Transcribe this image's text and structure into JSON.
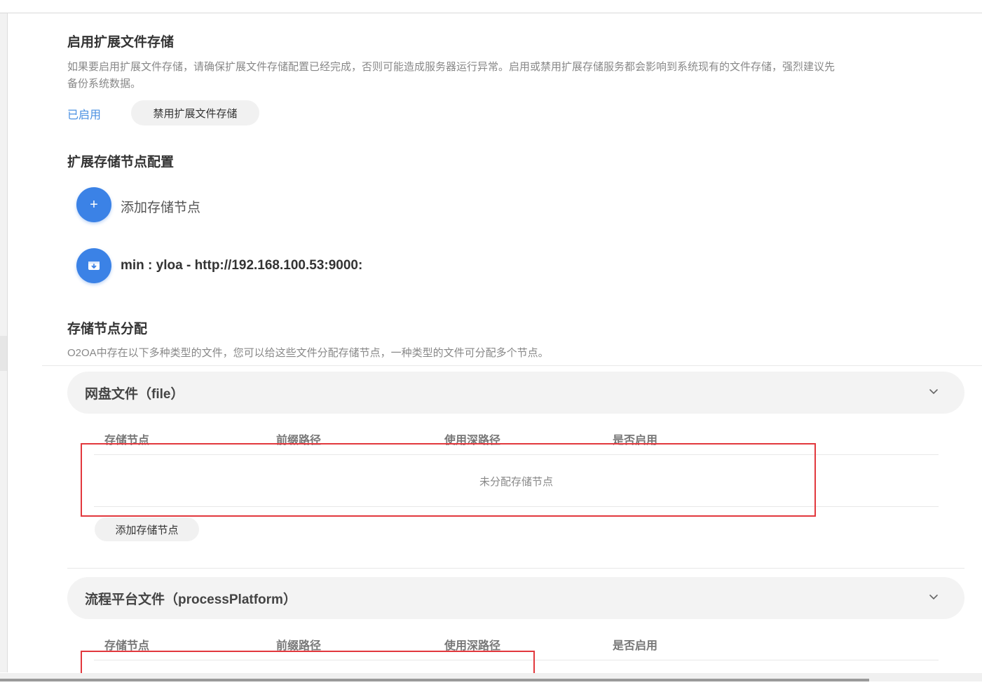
{
  "extended_storage": {
    "title": "启用扩展文件存储",
    "description": "如果要启用扩展文件存储，请确保扩展文件存储配置已经完成，否则可能造成服务器运行异常。启用或禁用扩展存储服务都会影响到系统现有的文件存储，强烈建议先",
    "description_line2": "备份系统数据。",
    "status_label": "已启用",
    "disable_button": "禁用扩展文件存储"
  },
  "node_config": {
    "title": "扩展存储节点配置",
    "add_icon_glyph": "+",
    "add_label": "添加存储节点",
    "nodes": [
      {
        "label": "min : yloa - http://192.168.100.53:9000:",
        "icon": "storage-box-icon"
      }
    ]
  },
  "distribution": {
    "title": "存储节点分配",
    "description": "O2OA中存在以下多种类型的文件，您可以给这些文件分配存储节点，一种类型的文件可分配多个节点。",
    "columns": [
      "存储节点",
      "前缀路径",
      "使用深路径",
      "是否启用"
    ],
    "groups": [
      {
        "title": "网盘文件（file）",
        "empty_text": "未分配存储节点",
        "add_button": "添加存储节点"
      },
      {
        "title": "流程平台文件（processPlatform）"
      }
    ]
  },
  "colors": {
    "accent": "#3b82e6",
    "link": "#4a90e2",
    "highlight": "#e2383d"
  }
}
